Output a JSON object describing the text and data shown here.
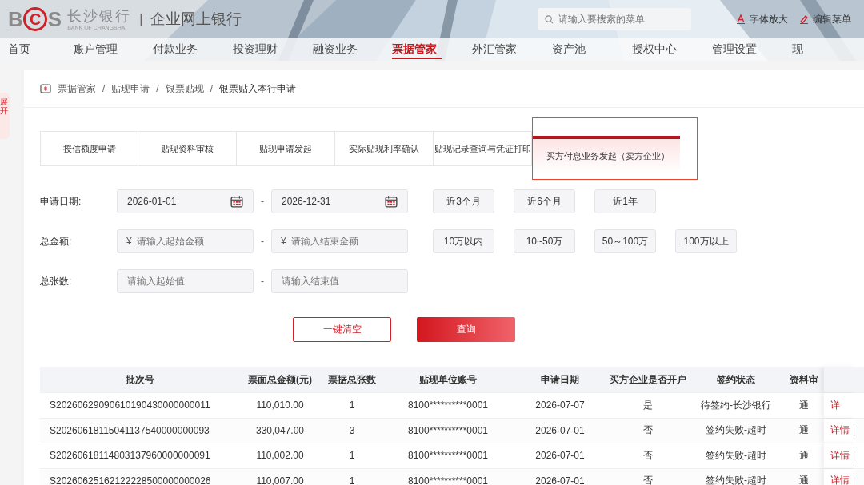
{
  "header": {
    "logo": {
      "b": "B",
      "c": "C",
      "s": "S"
    },
    "bank_name": "长沙银行",
    "bank_name_en": "BANK OF CHANGSHA",
    "separator": "|",
    "product": "企业网上银行",
    "search": {
      "placeholder": "请输入要搜索的菜单"
    },
    "actions": [
      {
        "kind": "font",
        "label": "字体放大"
      },
      {
        "kind": "edit",
        "label": "编辑菜单"
      }
    ]
  },
  "nav": [
    {
      "label": "首页",
      "selected": false
    },
    {
      "label": "账户管理",
      "selected": false
    },
    {
      "label": "付款业务",
      "selected": false
    },
    {
      "label": "投资理财",
      "selected": false
    },
    {
      "label": "融资业务",
      "selected": false
    },
    {
      "label": "票据管家",
      "selected": true
    },
    {
      "label": "外汇管家",
      "selected": false
    },
    {
      "label": "资产池",
      "selected": false
    },
    {
      "label": "授权中心",
      "selected": false
    },
    {
      "label": "管理设置",
      "selected": false
    },
    {
      "label": "现",
      "selected": false
    }
  ],
  "side_tab": "展开",
  "breadcrumb": [
    "票据管家",
    "贴现申请",
    "银票贴现",
    "银票贴入本行申请"
  ],
  "breadcrumb_separator": "/",
  "action_separator": "|",
  "tabs": [
    {
      "label": "授信额度申请",
      "selected": false
    },
    {
      "label": "贴现资料审核",
      "selected": false
    },
    {
      "label": "贴现申请发起",
      "selected": false
    },
    {
      "label": "实际贴现利率确认",
      "selected": false
    },
    {
      "label": "贴现记录查询与凭证打印",
      "selected": false
    },
    {
      "label": "买方付息业务发起（卖方企业）",
      "selected": true
    }
  ],
  "filters": [
    {
      "kind": "date",
      "label": "申请日期:",
      "from": "2026-01-01",
      "to": "2026-12-31",
      "quick": [
        "近3个月",
        "近6个月",
        "近1年"
      ]
    },
    {
      "kind": "amount",
      "label": "总金额:",
      "currency": "¥",
      "from_placeholder": "请输入起始金额",
      "to_placeholder": "请输入结束金额",
      "quick": [
        "10万以内",
        "10~50万",
        "50～100万",
        "100万以上"
      ]
    },
    {
      "kind": "count",
      "label": "总张数:",
      "from_placeholder": "请输入起始值",
      "to_placeholder": "请输入结束值"
    }
  ],
  "range_separator": "-",
  "buttons": [
    {
      "kind": "reset",
      "label": "一键清空"
    },
    {
      "kind": "query",
      "label": "查询"
    }
  ],
  "table": {
    "columns": [
      "批次号",
      "票面总金额(元)",
      "票据总张数",
      "贴现单位账号",
      "申请日期",
      "买方企业是否开户",
      "签约状态",
      "资料审"
    ],
    "rows": [
      {
        "cells": [
          "S20260629090610190430000000011",
          "110,010.00",
          "1",
          "8100**********0001",
          "2026-07-07",
          "是",
          "待签约-长沙银行",
          "通"
        ],
        "action": "详",
        "more": false
      },
      {
        "cells": [
          "S20260618115041137540000000093",
          "330,047.00",
          "3",
          "8100**********0001",
          "2026-07-01",
          "否",
          "签约失败-超时",
          "通"
        ],
        "action": "详情",
        "more": true
      },
      {
        "cells": [
          "S20260618114803137960000000091",
          "110,002.00",
          "1",
          "8100**********0001",
          "2026-07-01",
          "否",
          "签约失败-超时",
          "通"
        ],
        "action": "详情",
        "more": true
      },
      {
        "cells": [
          "S20260625162122228500000000026",
          "110,007.00",
          "1",
          "8100**********0001",
          "2026-07-01",
          "否",
          "签约失败-超时",
          "通"
        ],
        "action": "详情",
        "more": true
      }
    ]
  }
}
